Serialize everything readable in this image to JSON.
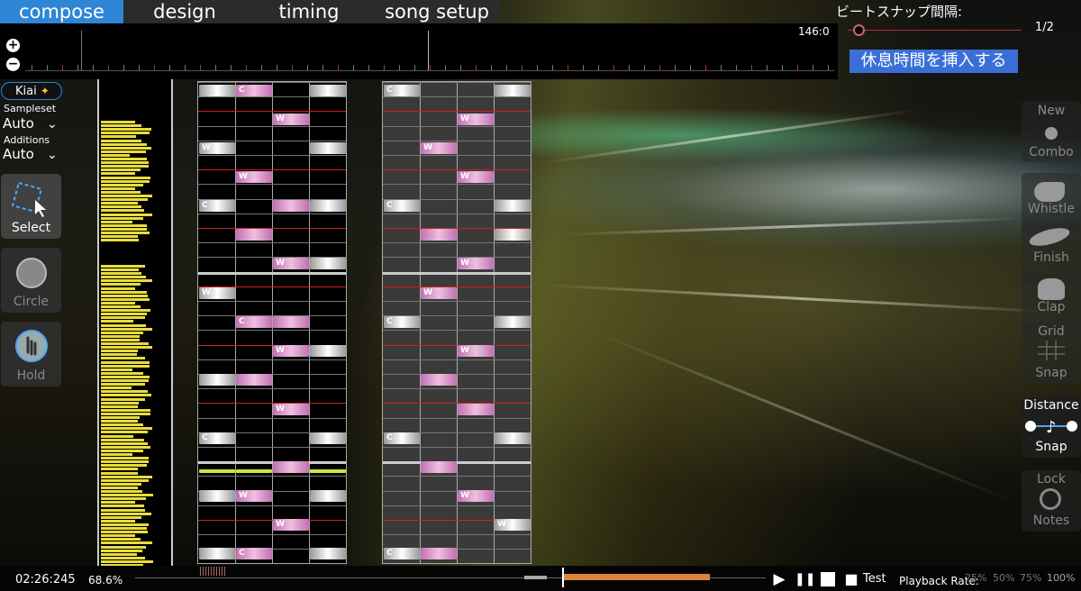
{
  "tabs": [
    {
      "label": "compose",
      "active": true
    },
    {
      "label": "design",
      "active": false
    },
    {
      "label": "timing",
      "active": false
    },
    {
      "label": "song setup",
      "active": false
    }
  ],
  "timeline": {
    "zoom_in_icon": "plus-circle-icon",
    "zoom_out_icon": "minus-circle-icon"
  },
  "beat_snap": {
    "label": "ビートスナップ間隔:",
    "left_value": "146:0",
    "value": "1/2"
  },
  "insert_break_button": "休息時間を挿入する",
  "left_panel": {
    "kiai": "Kiai",
    "sampleset_label": "Sampleset",
    "sampleset_value": "Auto",
    "additions_label": "Additions",
    "additions_value": "Auto",
    "tools": [
      {
        "label": "Select",
        "icon": "select-cursor-icon",
        "active": true
      },
      {
        "label": "Circle",
        "icon": "circle-icon",
        "active": false
      },
      {
        "label": "Hold",
        "icon": "hold-hand-icon",
        "active": false
      }
    ]
  },
  "right_panel": [
    {
      "label_top": "New",
      "label_bottom": "Combo",
      "icon": "new-combo-icon",
      "active": false
    },
    {
      "label_top": "",
      "label_bottom": "Whistle",
      "icon": "whistle-icon",
      "active": false
    },
    {
      "label_top": "",
      "label_bottom": "Finish",
      "icon": "cymbal-icon",
      "active": false
    },
    {
      "label_top": "",
      "label_bottom": "Clap",
      "icon": "clap-icon",
      "active": false
    },
    {
      "label_top": "Grid",
      "label_bottom": "Snap",
      "icon": "grid-snap-icon",
      "active": false
    },
    {
      "label_top": "Distance",
      "label_bottom": "Snap",
      "icon": "distance-snap-icon",
      "active": true
    },
    {
      "label_top": "Lock",
      "label_bottom": "Notes",
      "icon": "lock-notes-icon",
      "active": false
    }
  ],
  "note_letters": {
    "clap": "C",
    "whistle": "W"
  },
  "bottom": {
    "time": "02:26:245",
    "percent": "68.6%",
    "test_label": "Test",
    "playback_rate_label": "Playback Rate:",
    "rates": [
      "25%",
      "50%",
      "75%",
      "100%"
    ],
    "play_icon": "play-icon",
    "pause_icon": "pause-icon",
    "stop_icon": "stop-icon",
    "test_icon": "camera-icon"
  },
  "colors": {
    "accent": "#2f86d6",
    "whistle_note": "#e9a6d8",
    "waveform": "#e8dd3c",
    "beat_line": "#cc2222"
  }
}
